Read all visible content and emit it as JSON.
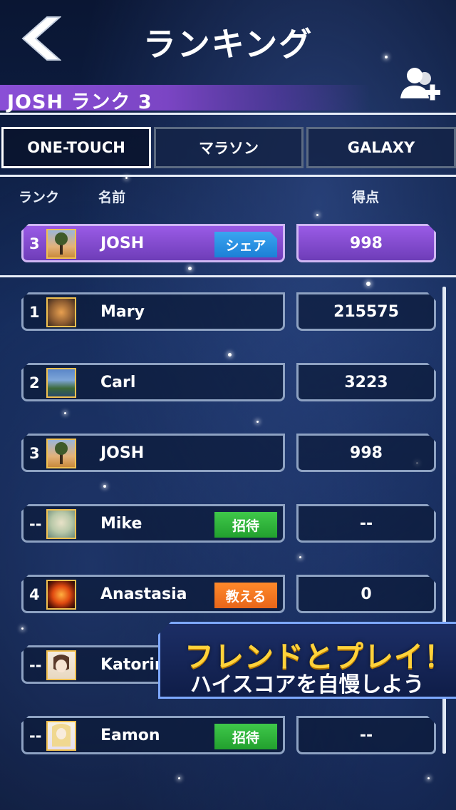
{
  "header": {
    "title": "ランキング",
    "back_icon": "chevron-left-icon"
  },
  "player": {
    "name_rank": "JOSH ランク 3",
    "add_friend_icon": "add-friend-icon"
  },
  "tabs": [
    {
      "label": "ONE-TOUCH",
      "active": true
    },
    {
      "label": "マラソン",
      "active": false
    },
    {
      "label": "GALAXY",
      "active": false
    }
  ],
  "columns": {
    "rank": "ランク",
    "name": "名前",
    "score": "得点"
  },
  "my_entry": {
    "rank": "3",
    "name": "JOSH",
    "action": "シェア",
    "score": "998"
  },
  "rows": [
    {
      "rank": "1",
      "name": "Mary",
      "score": "215575",
      "action": "",
      "avatar": "tiger"
    },
    {
      "rank": "2",
      "name": "Carl",
      "score": "3223",
      "action": "",
      "avatar": "mountain"
    },
    {
      "rank": "3",
      "name": "JOSH",
      "score": "998",
      "action": "",
      "avatar": "tree"
    },
    {
      "rank": "--",
      "name": "Mike",
      "score": "--",
      "action": "招待",
      "avatar": "skull"
    },
    {
      "rank": "4",
      "name": "Anastasia",
      "score": "0",
      "action": "教える",
      "avatar": "sun"
    },
    {
      "rank": "--",
      "name": "Katorinu",
      "score": "",
      "action": "",
      "avatar": "anime"
    },
    {
      "rank": "--",
      "name": "Eamon",
      "score": "--",
      "action": "招待",
      "avatar": "anime-blonde"
    }
  ],
  "promo": {
    "title": "フレンドとプレイ！",
    "subtitle": "ハイスコアを自慢しよう"
  },
  "colors": {
    "accent_purple": "#8a4fd6",
    "share_blue": "#2a90e3",
    "invite_green": "#2fb43b",
    "teach_orange": "#f27420",
    "promo_gold": "#ffd23a"
  }
}
